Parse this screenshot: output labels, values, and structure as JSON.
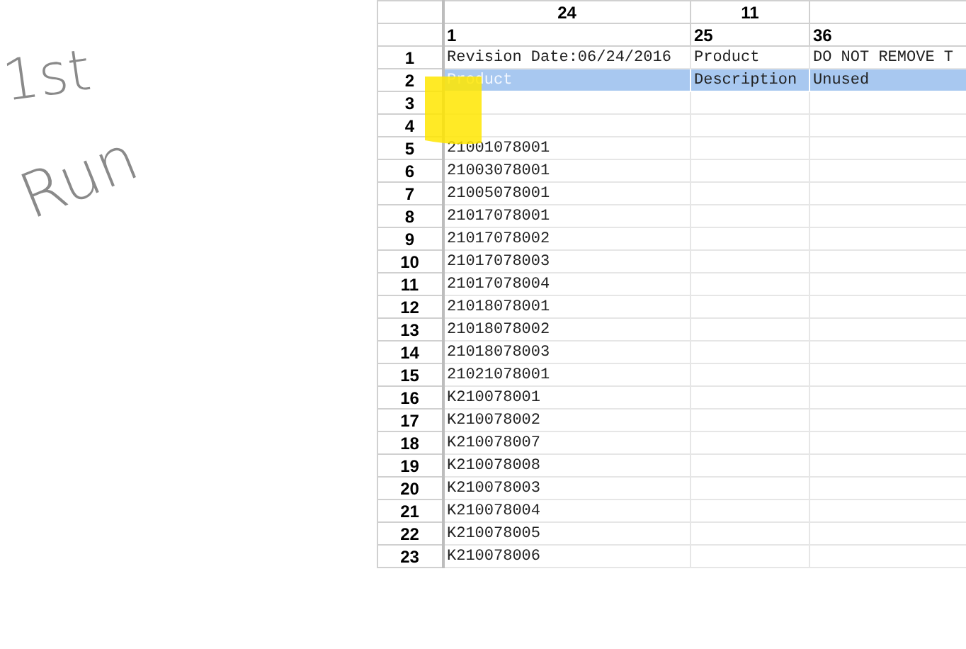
{
  "annotation": {
    "lines": [
      "1st",
      "Run"
    ]
  },
  "header_rows": [
    [
      "24",
      "11",
      ""
    ],
    [
      "1",
      "25",
      "36"
    ]
  ],
  "rows": [
    {
      "number": "1",
      "selected": false,
      "cells": [
        "Revision Date:06/24/2016",
        "Product",
        "DO NOT REMOVE T"
      ]
    },
    {
      "number": "2",
      "selected": true,
      "cells": [
        "Product",
        "Description",
        "Unused"
      ]
    },
    {
      "number": "3",
      "selected": false,
      "cells": [
        "",
        "",
        ""
      ]
    },
    {
      "number": "4",
      "selected": false,
      "cells": [
        "",
        "",
        ""
      ]
    },
    {
      "number": "5",
      "selected": false,
      "cells": [
        "21001078001",
        "",
        ""
      ]
    },
    {
      "number": "6",
      "selected": false,
      "cells": [
        "21003078001",
        "",
        ""
      ]
    },
    {
      "number": "7",
      "selected": false,
      "cells": [
        "21005078001",
        "",
        ""
      ]
    },
    {
      "number": "8",
      "selected": false,
      "cells": [
        "21017078001",
        "",
        ""
      ]
    },
    {
      "number": "9",
      "selected": false,
      "cells": [
        "21017078002",
        "",
        ""
      ]
    },
    {
      "number": "10",
      "selected": false,
      "cells": [
        "21017078003",
        "",
        ""
      ]
    },
    {
      "number": "11",
      "selected": false,
      "cells": [
        "21017078004",
        "",
        ""
      ]
    },
    {
      "number": "12",
      "selected": false,
      "cells": [
        "21018078001",
        "",
        ""
      ]
    },
    {
      "number": "13",
      "selected": false,
      "cells": [
        "21018078002",
        "",
        ""
      ]
    },
    {
      "number": "14",
      "selected": false,
      "cells": [
        "21018078003",
        "",
        ""
      ]
    },
    {
      "number": "15",
      "selected": false,
      "cells": [
        "21021078001",
        "",
        ""
      ]
    },
    {
      "number": "16",
      "selected": false,
      "cells": [
        "K210078001",
        "",
        ""
      ]
    },
    {
      "number": "17",
      "selected": false,
      "cells": [
        "K210078002",
        "",
        ""
      ]
    },
    {
      "number": "18",
      "selected": false,
      "cells": [
        "K210078007",
        "",
        ""
      ]
    },
    {
      "number": "19",
      "selected": false,
      "cells": [
        "K210078008",
        "",
        ""
      ]
    },
    {
      "number": "20",
      "selected": false,
      "cells": [
        "K210078003",
        "",
        ""
      ]
    },
    {
      "number": "21",
      "selected": false,
      "cells": [
        "K210078004",
        "",
        ""
      ]
    },
    {
      "number": "22",
      "selected": false,
      "cells": [
        "K210078005",
        "",
        ""
      ]
    },
    {
      "number": "23",
      "selected": false,
      "cells": [
        "K210078006",
        "",
        ""
      ]
    }
  ]
}
